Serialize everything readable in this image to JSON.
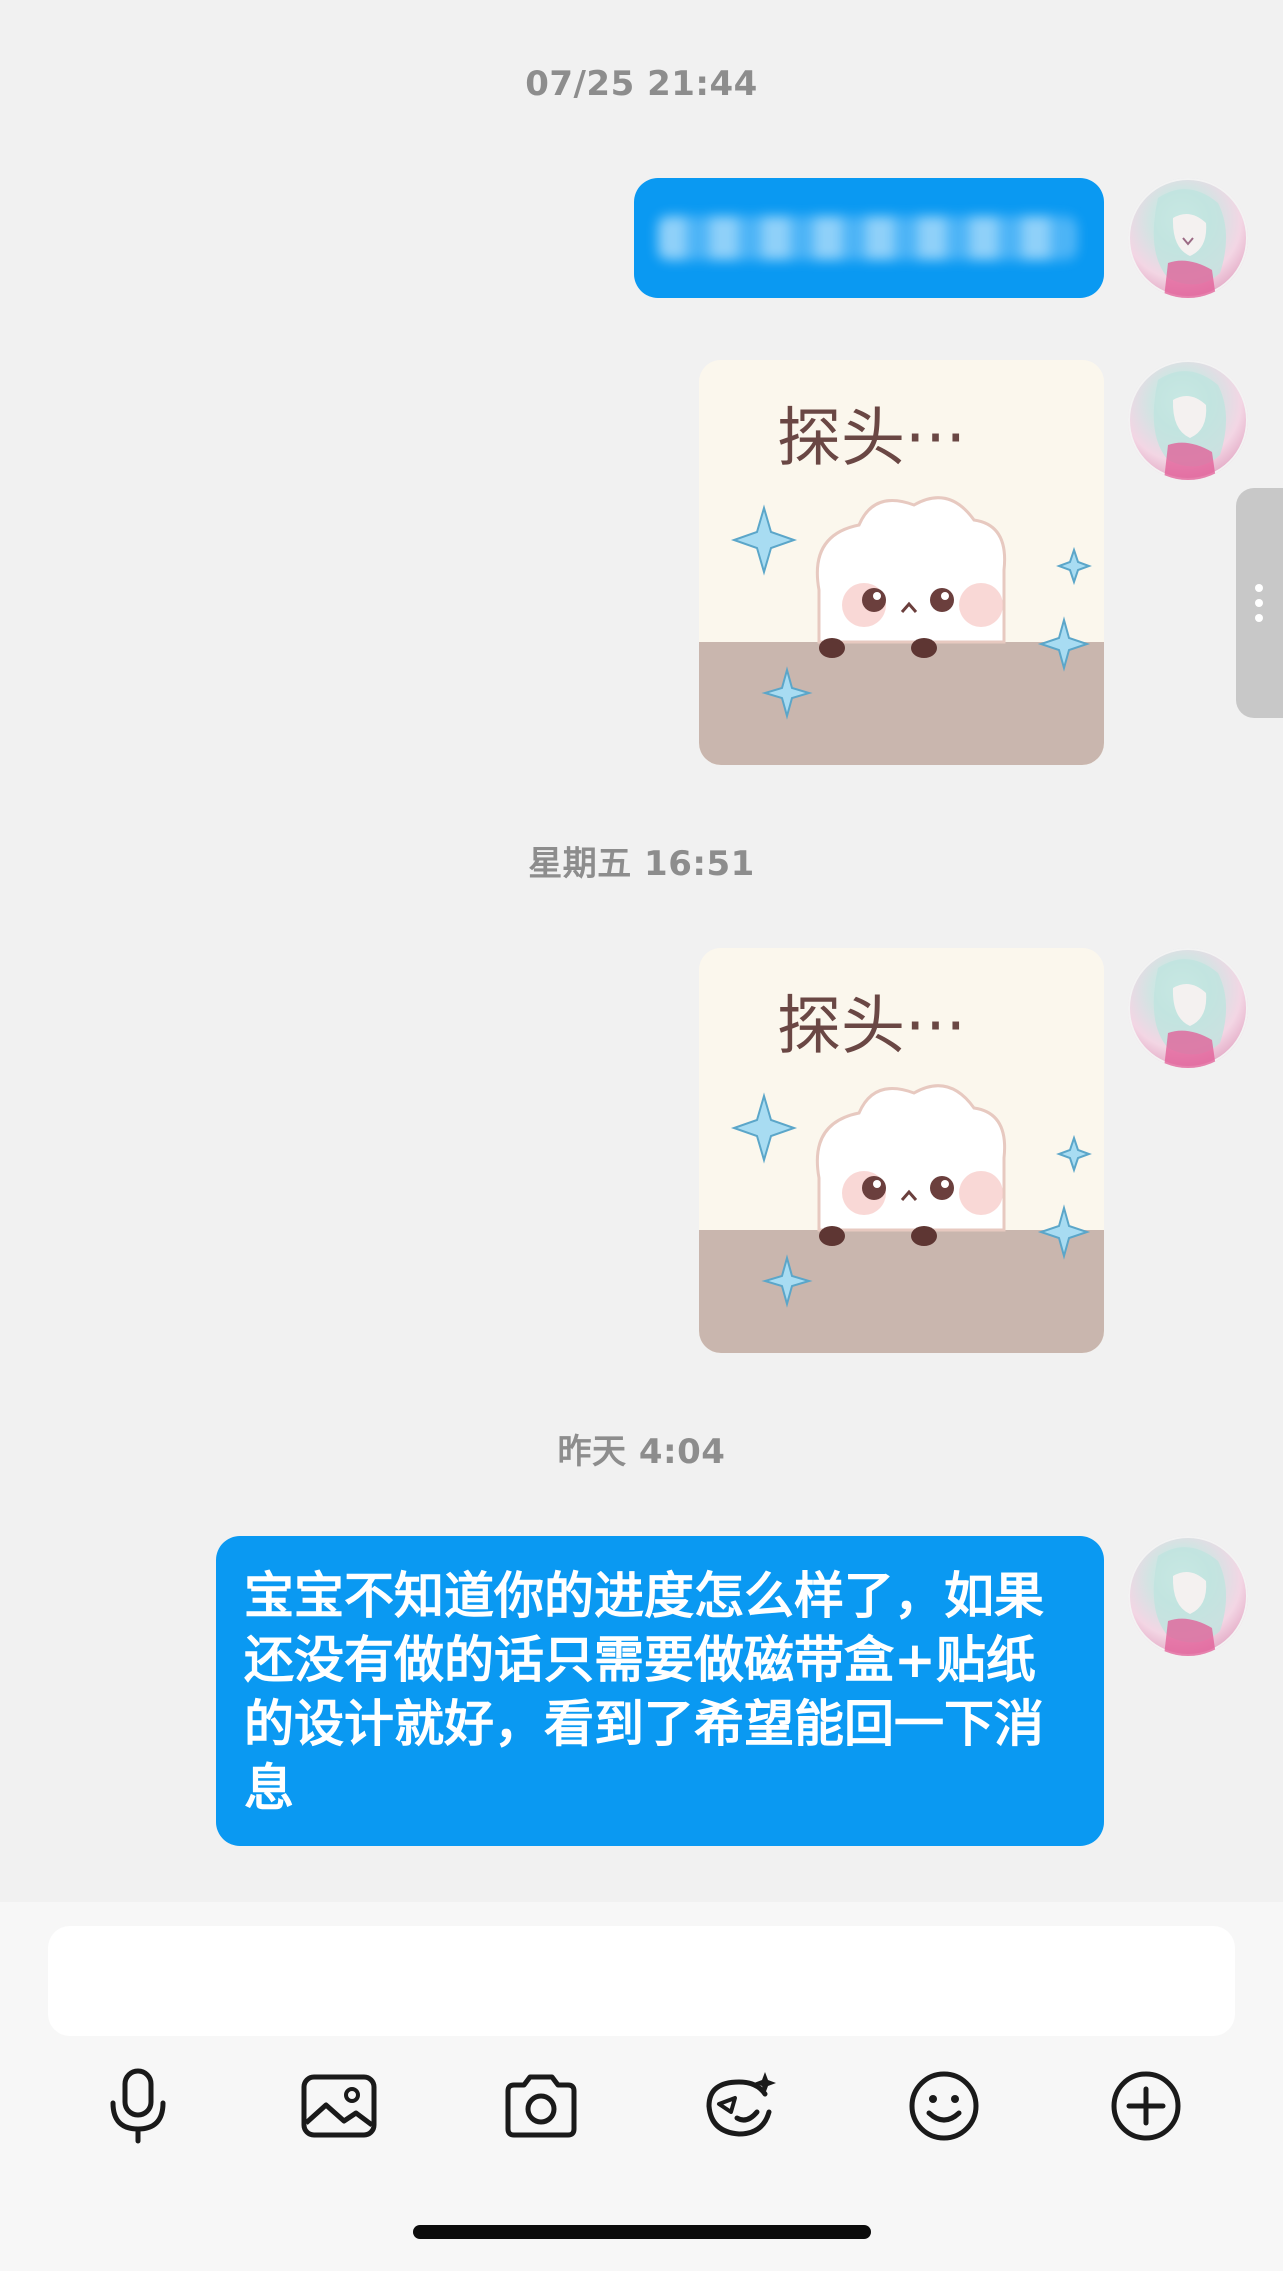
{
  "timestamps": [
    "07/25 21:44",
    "星期五 16:51",
    "昨天 4:04"
  ],
  "messages": {
    "first_text": "",
    "sticker_caption": "探头···",
    "last_text": "宝宝不知道你的进度怎么样了，如果还没有做的话只需要做磁带盒+贴纸的设计就好，看到了希望能回一下消息"
  },
  "input": {
    "placeholder": ""
  },
  "toolbar": {
    "icons": [
      "microphone-icon",
      "image-icon",
      "camera-icon",
      "emoji-sparkle-icon",
      "smile-icon",
      "plus-circle-icon"
    ]
  },
  "colors": {
    "bubble": "#0a99f2",
    "background": "#f1f1f1",
    "timestamp": "#8d8d8d"
  }
}
